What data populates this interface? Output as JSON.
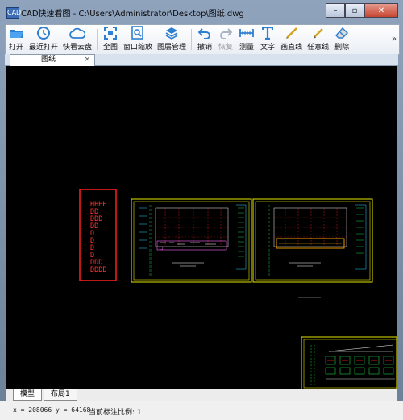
{
  "window": {
    "app_icon": "CAD",
    "title": "CAD快速看图 - C:\\Users\\Administrator\\Desktop\\图纸.dwg",
    "controls": [
      "minimize",
      "maximize",
      "close"
    ]
  },
  "toolbar": {
    "items": [
      {
        "label": "打开",
        "icon": "folder-open-icon",
        "enabled": true
      },
      {
        "label": "最近打开",
        "icon": "recent-clock-icon",
        "enabled": true
      },
      {
        "label": "快看云盘",
        "icon": "cloud-icon",
        "enabled": true
      },
      {
        "label": "全图",
        "icon": "fit-all-icon",
        "enabled": true
      },
      {
        "label": "窗口缩放",
        "icon": "zoom-window-icon",
        "enabled": true
      },
      {
        "label": "图层管理",
        "icon": "layers-icon",
        "enabled": true
      },
      {
        "label": "撤销",
        "icon": "undo-icon",
        "enabled": true
      },
      {
        "label": "恢复",
        "icon": "redo-icon",
        "enabled": false
      },
      {
        "label": "测量",
        "icon": "measure-icon",
        "enabled": true
      },
      {
        "label": "文字",
        "icon": "text-icon",
        "enabled": true
      },
      {
        "label": "画直线",
        "icon": "line-icon",
        "enabled": true
      },
      {
        "label": "任意线",
        "icon": "freehand-icon",
        "enabled": true
      },
      {
        "label": "删除",
        "icon": "eraser-icon",
        "enabled": true
      }
    ],
    "expand_glyph": "»"
  },
  "document_tab": {
    "label": "图纸",
    "close": "×"
  },
  "drawing": {
    "legend_lines": [
      "HHHH",
      "DD",
      "DDD",
      "DD",
      "D",
      "D",
      "D",
      "D",
      "DDD",
      "DDDD"
    ],
    "colors": {
      "background": "#000000",
      "frame": "#e6e600",
      "red": "#ff2020",
      "green": "#22cc44",
      "cyan": "#33ccff",
      "white": "#ffffff"
    }
  },
  "layout_tabs": [
    {
      "label": "模型",
      "active": true
    },
    {
      "label": "布局1",
      "active": false
    }
  ],
  "status": {
    "coords": "x = 208066  y = 64168",
    "scale": "当前标注比例: 1"
  }
}
